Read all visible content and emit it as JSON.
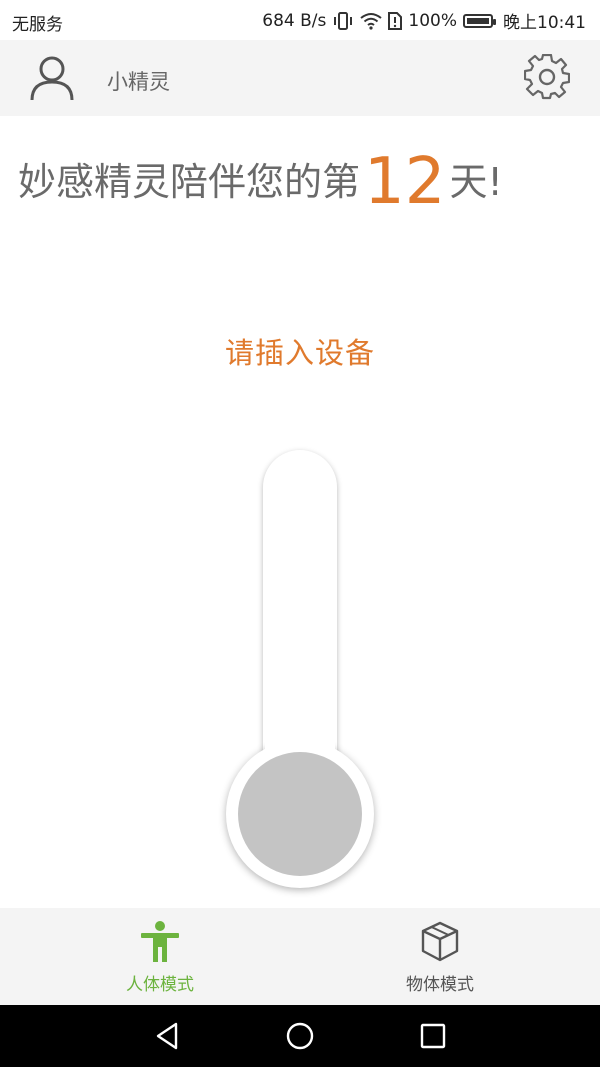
{
  "status_bar": {
    "carrier": "无服务",
    "speed": "684 B/s",
    "battery": "100%",
    "time": "晚上10:41",
    "icons": [
      "vibrate-icon",
      "wifi-icon",
      "sim-alert-icon",
      "battery-icon"
    ]
  },
  "app_bar": {
    "title": "小精灵",
    "icons": [
      "avatar-icon",
      "settings-gear-icon"
    ]
  },
  "headline": {
    "prefix": "妙感精灵陪伴您的第",
    "days": "12",
    "suffix": "天!"
  },
  "prompt": "请插入设备",
  "tabs": [
    {
      "label": "人体模式",
      "icon": "person-icon",
      "active": true
    },
    {
      "label": "物体模式",
      "icon": "box-icon",
      "active": false
    }
  ],
  "nav": {
    "icons": [
      "back-icon",
      "home-icon",
      "recents-icon"
    ]
  },
  "colors": {
    "accent": "#e07a2d",
    "active_tab": "#6cb33e",
    "text_gray": "#6a6a6a",
    "bulb": "#c4c4c4"
  }
}
